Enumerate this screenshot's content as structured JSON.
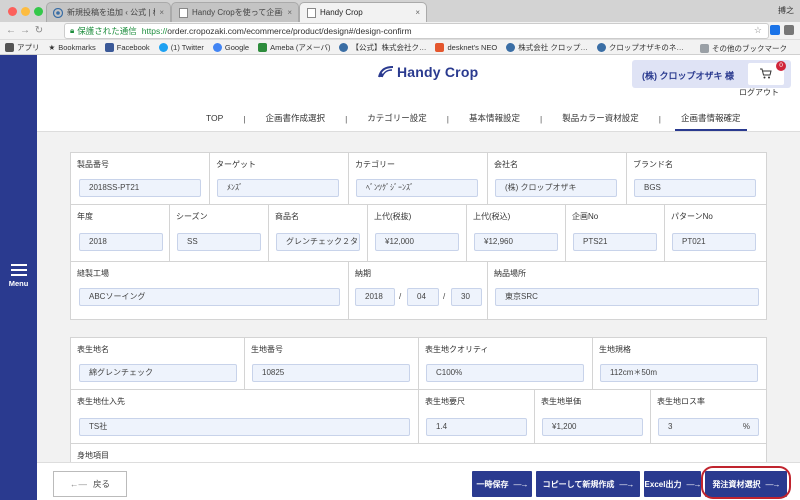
{
  "browser": {
    "tabs": [
      {
        "title": "新規投稿を追加 ‹ 公式 | 株式会社"
      },
      {
        "title": "Handy Cropを使って企画書を作"
      },
      {
        "title": "Handy Crop"
      }
    ],
    "profile_name": "搏之",
    "secure_label": "保護された通信",
    "url_scheme": "https://",
    "url_rest": "order.cropozaki.com/ecommerce/product/design#/design-confirm",
    "bookmarks": [
      "アプリ",
      "Bookmarks",
      "Facebook",
      "(1) Twitter",
      "Google",
      "Ameba (アメーバ)",
      "【公式】株式会社ク…",
      "desknet's NEO",
      "株式会社 クロップ…",
      "クロップオザキのネ…"
    ],
    "other_bookmarks": "その他のブックマーク"
  },
  "sidebar": {
    "menu_label": "Menu"
  },
  "header": {
    "logo_text": "Handy Crop",
    "account_name": "(株) クロップオザキ 様",
    "cart_count": "0",
    "logout": "ログアウト"
  },
  "nav": {
    "items": [
      "TOP",
      "企画書作成選択",
      "カテゴリー設定",
      "基本情報設定",
      "製品カラー資材設定",
      "企画書情報確定"
    ],
    "active_index": 5
  },
  "product": {
    "product_no": {
      "label": "製品番号",
      "value": "2018SS-PT21"
    },
    "target": {
      "label": "ターゲット",
      "value": "ﾒﾝｽﾞ"
    },
    "category": {
      "label": "カテゴリー",
      "value": "ﾍﾞﾝﾂｸﾞｼﾞｰﾝｽﾞ"
    },
    "company": {
      "label": "会社名",
      "value": "(株) クロップオザキ"
    },
    "brand": {
      "label": "ブランド名",
      "value": "BGS"
    },
    "year": {
      "label": "年度",
      "value": "2018"
    },
    "season": {
      "label": "シーズン",
      "value": "SS"
    },
    "item_name": {
      "label": "商品名",
      "value": "グレンチェック２タ"
    },
    "price_ex_tax": {
      "label": "上代(税抜)",
      "value": "¥12,000"
    },
    "price_in_tax": {
      "label": "上代(税込)",
      "value": "¥12,960"
    },
    "plan_no": {
      "label": "企画No",
      "value": "PTS21"
    },
    "pattern_no": {
      "label": "パターンNo",
      "value": "PT021"
    },
    "factory": {
      "label": "縫製工場",
      "value": "ABCソーイング"
    },
    "delivery": {
      "label": "納期",
      "year": "2018",
      "month": "04",
      "day": "30"
    },
    "delivery_place": {
      "label": "納品場所",
      "value": "東京SRC"
    }
  },
  "fabric": {
    "name": {
      "label": "表生地名",
      "value": "綿グレンチェック"
    },
    "number": {
      "label": "生地番号",
      "value": "10825"
    },
    "quality": {
      "label": "表生地クオリティ",
      "value": "C100%"
    },
    "spec": {
      "label": "生地規格",
      "value": "112cm＊50m"
    },
    "supplier": {
      "label": "表生地仕入先",
      "value": "TS社"
    },
    "required_length": {
      "label": "表生地要尺",
      "value": "1.4"
    },
    "unit_price": {
      "label": "表生地単価",
      "value": "¥1,200"
    },
    "loss_rate": {
      "label": "表生地ロス率",
      "value": "3",
      "unit": "%"
    },
    "next_label": "身地項目"
  },
  "footer": {
    "back": "戻る",
    "save": "一時保存",
    "copy_new": "コピーして新規作成",
    "excel": "Excel出力",
    "order_material": "発注資材選択"
  },
  "colors": {
    "brand": "#2a3a8f",
    "highlight": "#c0242e",
    "field_bg": "#eef3fc",
    "content_bg": "#f2f2f2"
  }
}
